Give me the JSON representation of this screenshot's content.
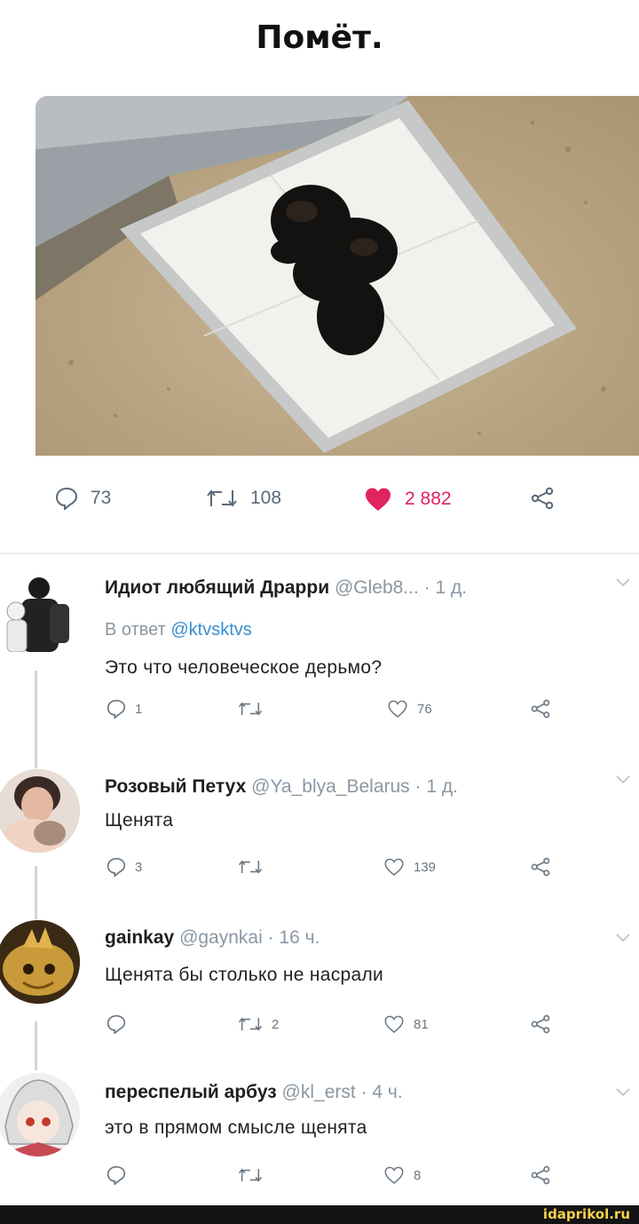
{
  "meme": {
    "title": "Помёт."
  },
  "tweet_stats": {
    "replies": "73",
    "retweets": "108",
    "likes": "2 882",
    "colors": {
      "icon": "#5a6a78",
      "like": "#e0245e"
    }
  },
  "comments": [
    {
      "name": "Идиот любящий Драрри",
      "meta": "@Gleb8... · 1 д.",
      "reply_prefix": "В ответ",
      "reply_handle": "@ktvsktvs",
      "text": "Это что человеческое дерьмо?",
      "replies": "1",
      "retweets": "",
      "likes": "76"
    },
    {
      "name": "Розовый Петух",
      "meta": "@Ya_blya_Belarus · 1 д.",
      "text": "Щенята",
      "replies": "3",
      "retweets": "",
      "likes": "139"
    },
    {
      "name": "gainkay",
      "meta": "@gaynkai · 16 ч.",
      "text": "Щенята бы столько не насрали",
      "replies": "",
      "retweets": "2",
      "likes": "81"
    },
    {
      "name": "переспелый арбуз",
      "meta": "@kl_erst · 4 ч.",
      "text": "это в прямом смысле щенята",
      "replies": "",
      "retweets": "",
      "likes": "8"
    }
  ],
  "footer": {
    "watermark": "idaprikol.ru"
  }
}
